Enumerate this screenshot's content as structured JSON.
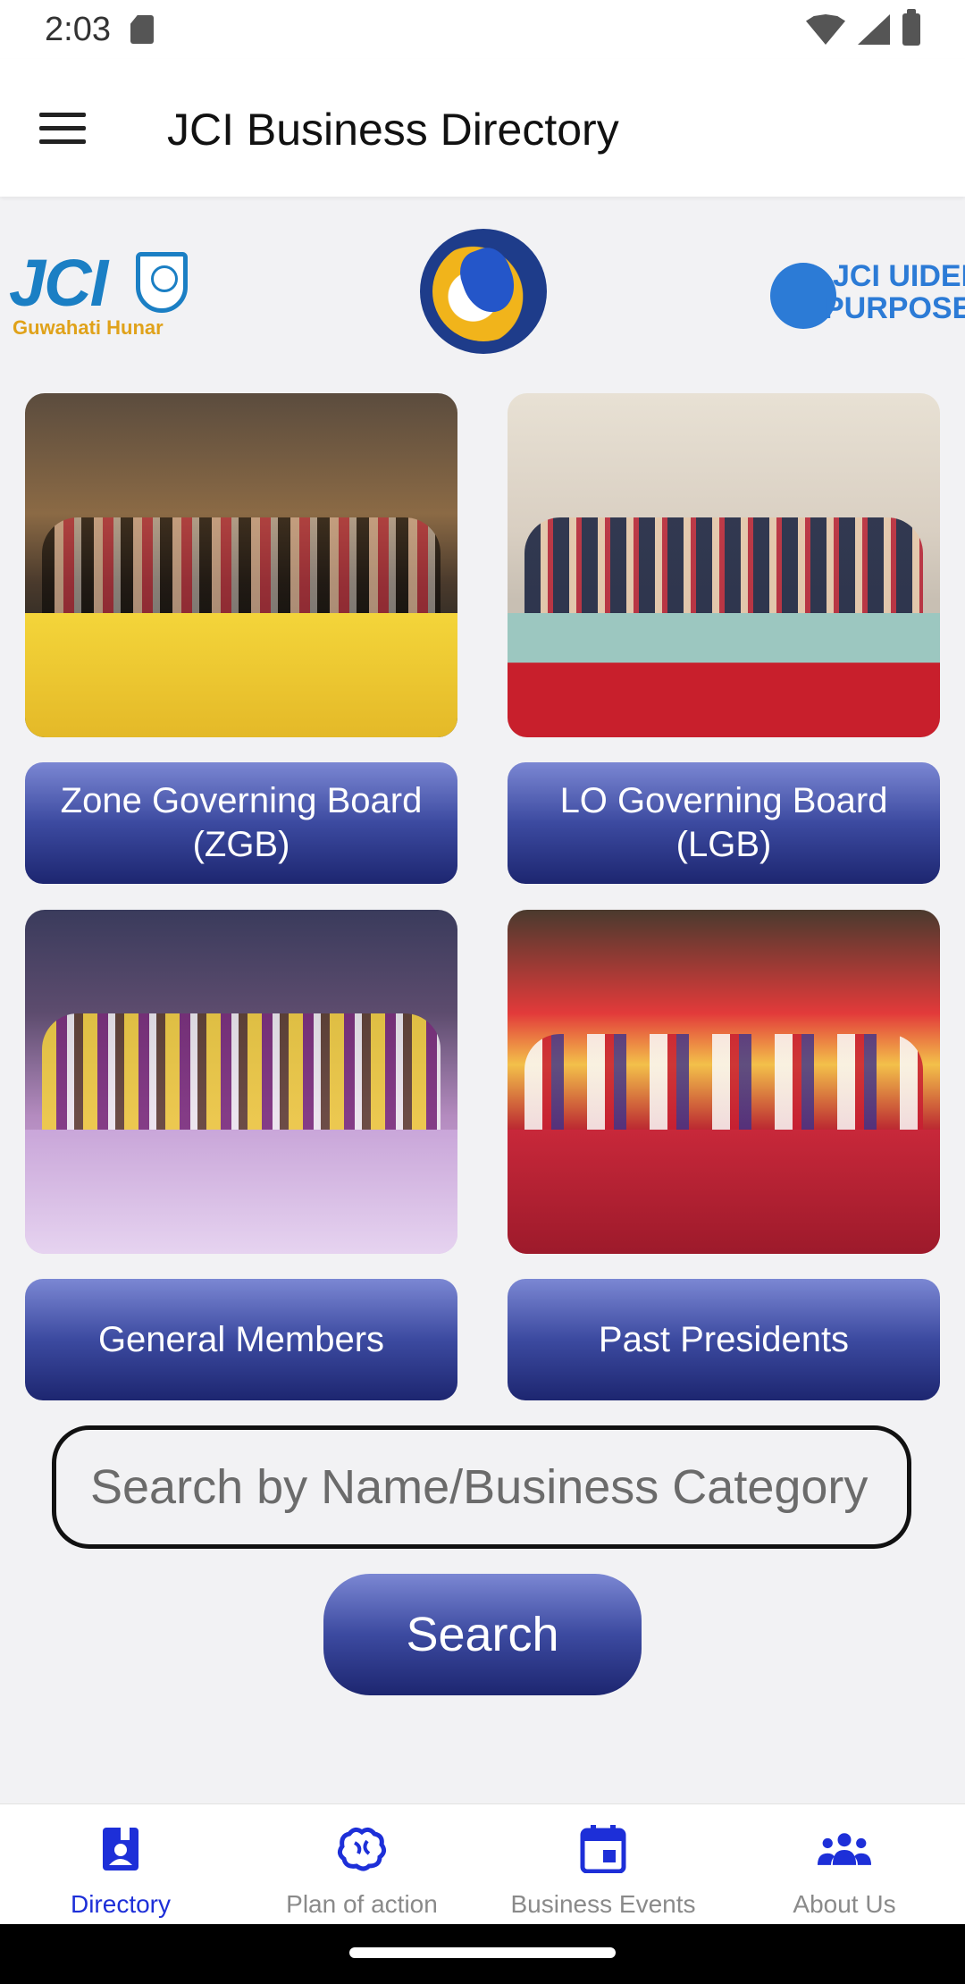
{
  "status_bar": {
    "time": "2:03"
  },
  "app_bar": {
    "title": "JCI Business Directory"
  },
  "logos": {
    "left": {
      "word": "JCI",
      "subtitle": "Guwahati Hunar"
    },
    "right": {
      "line1": "JCI UIDED·Y",
      "line2": "PURPOSE"
    }
  },
  "grid": {
    "zgb_label": "Zone Governing Board (ZGB)",
    "lgb_label": "LO Governing Board (LGB)",
    "gm_label": "General Members",
    "pp_label": "Past Presidents"
  },
  "search": {
    "placeholder": "Search by Name/Business Category",
    "value": "",
    "button_label": "Search"
  },
  "bottom_nav": {
    "items": [
      {
        "label": "Directory",
        "icon": "contact-book-icon",
        "active": true
      },
      {
        "label": "Plan of action",
        "icon": "brain-icon",
        "active": false
      },
      {
        "label": "Business Events",
        "icon": "calendar-icon",
        "active": false
      },
      {
        "label": "About Us",
        "icon": "group-icon",
        "active": false
      }
    ]
  },
  "colors": {
    "accent": "#1d2fd8",
    "button_dark": "#1d2670",
    "button_light": "#7b87d3",
    "jci_blue": "#1b7fc4",
    "jci_gold": "#e0a21a"
  }
}
